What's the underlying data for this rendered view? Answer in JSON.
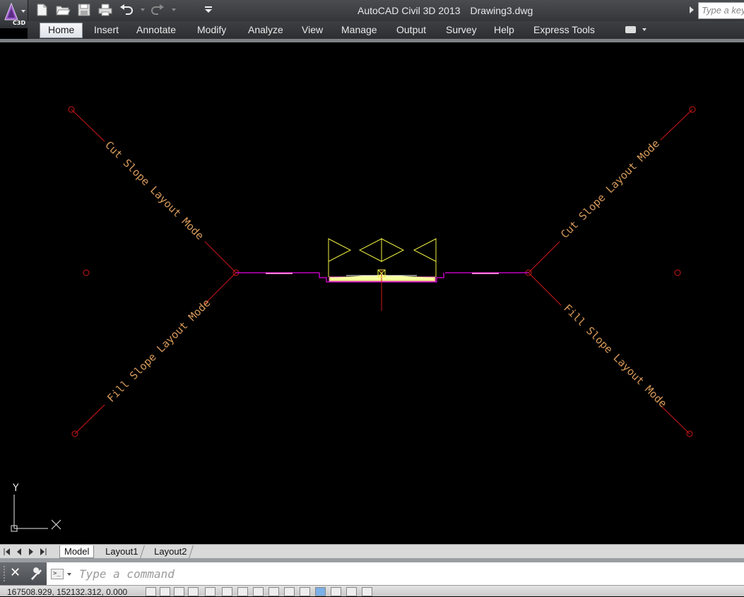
{
  "app": {
    "badge": "C3D",
    "title_app": "AutoCAD Civil 3D 2013",
    "title_doc": "Drawing3.dwg",
    "search_placeholder": "Type a keyword or phrase"
  },
  "quick_access": {
    "icons": [
      "new-icon",
      "open-icon",
      "save-icon",
      "plot-icon",
      "undo-icon",
      "redo-icon",
      "customize-dropdown-icon"
    ]
  },
  "menu": {
    "items": [
      "Home",
      "Insert",
      "Annotate",
      "Modify",
      "Analyze",
      "View",
      "Manage",
      "Output",
      "Survey",
      "Help",
      "Express Tools"
    ],
    "active": "Home"
  },
  "drawing": {
    "labels": {
      "cut_left": "Cut Slope Layout Mode",
      "fill_left": "Fill Slope Layout Mode",
      "cut_right": "Cut Slope Layout Mode",
      "fill_right": "Fill Slope Layout Mode"
    },
    "ucs": {
      "x": "X",
      "y": "Y"
    },
    "colors": {
      "background": "#000000",
      "slope_lines": "#d01818",
      "label_text": "#d89a5a",
      "daylight_lines": "#c000c0",
      "assembly": "#f0f040",
      "ucs": "#e8e8e8"
    }
  },
  "layout_tabs": {
    "tabs": [
      "Model",
      "Layout1",
      "Layout2"
    ],
    "active": "Model"
  },
  "command_line": {
    "placeholder": "Type a command"
  },
  "status": {
    "coordinates": "167508.929, 152132.312, 0.000"
  }
}
